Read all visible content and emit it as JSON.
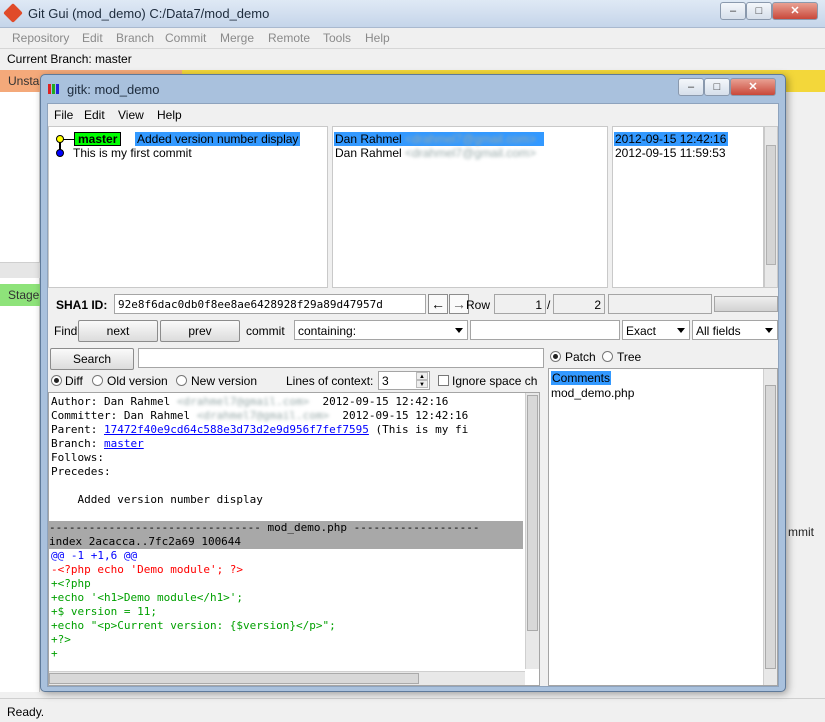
{
  "gitgui": {
    "title": "Git Gui (mod_demo) C:/Data7/mod_demo",
    "menu": [
      "Repository",
      "Edit",
      "Branch",
      "Commit",
      "Merge",
      "Remote",
      "Tools",
      "Help"
    ],
    "current_branch": "Current Branch: master",
    "unstaged_label": "Unsta",
    "staged_label": "Stage",
    "commit_button_fragment": "mmit",
    "status": "Ready."
  },
  "gitk": {
    "title": "gitk: mod_demo",
    "menu": [
      "File",
      "Edit",
      "View",
      "Help"
    ],
    "commits": [
      {
        "tag": "master",
        "message": "Added version number display",
        "author": "Dan Rahmel",
        "email": "<drahmel7@gmail.com>",
        "date": "2012-09-15 12:42:16",
        "selected": true
      },
      {
        "tag": "",
        "message": "This is my first commit",
        "author": "Dan Rahmel",
        "email": "<drahmel7@gmail.com>",
        "date": "2012-09-15 11:59:53",
        "selected": false
      }
    ],
    "sha_label": "SHA1 ID:",
    "sha_value": "92e8f6dac0db0f8ee8ae6428928f29a89d47957d",
    "row_label": "Row",
    "row_current": "1",
    "row_sep": "/",
    "row_total": "2",
    "find": {
      "label": "Find",
      "next": "next",
      "prev": "prev",
      "commit_label": "commit",
      "containing": "containing:",
      "exact": "Exact",
      "fields": "All fields"
    },
    "search_button": "Search",
    "diff_opts": {
      "diff": "Diff",
      "old": "Old version",
      "new": "New version",
      "context_label": "Lines of context:",
      "context_value": "3",
      "ignore_space": "Ignore space ch"
    },
    "diff_lines": {
      "author": "Author: Dan Rahmel",
      "author_email": "<drahmel7@gmail.com>",
      "author_date": "2012-09-15 12:42:16",
      "committer": "Committer: Dan Rahmel",
      "committer_email": "<drahmel7@gmail.com>",
      "committer_date": "2012-09-15 12:42:16",
      "parent_label": "Parent:",
      "parent_hash": "17472f40e9cd64c588e3d73d2e9d956f7fef7595",
      "parent_msg": "(This is my fi",
      "branch_label": "Branch:",
      "branch_value": "master",
      "follows": "Follows:",
      "precedes": "Precedes:",
      "message": "    Added version number display",
      "file_header": "-------------------------------- mod_demo.php -------------------",
      "index_line": "index 2acacca..7fc2a69 100644",
      "hunk": "@@ -1 +1,6 @@",
      "del1": "-<?php echo 'Demo module'; ?>",
      "add1": "+<?php",
      "add2": "+echo '<h1>Demo module</h1>';",
      "add3": "+$ version = 11;",
      "add4": "+echo \"<p>Current version: {$version}</p>\";",
      "add5": "+?>",
      "add6": "+"
    },
    "view": {
      "patch": "Patch",
      "tree": "Tree"
    },
    "files": [
      "Comments",
      "mod_demo.php"
    ]
  }
}
